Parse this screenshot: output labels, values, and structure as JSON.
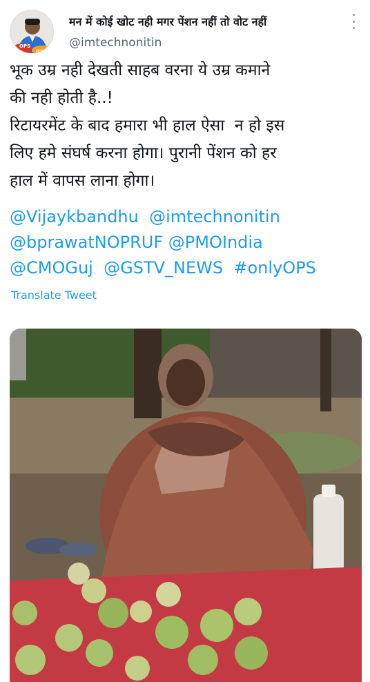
{
  "tweet": {
    "display_name": "मन में कोई खोट नही मगर पेंशन नहीं तो वोट नहीं",
    "handle": "@imtechnonitin",
    "avatar": {
      "badge_text": "OPS",
      "badge_text_2": "संघर्ष",
      "icon": "avatar-photo"
    },
    "more_icon": "more-vertical-icon",
    "text": "भूक उम्र नही देखती साहब वरना ये उम्र कमाने\nकी नही होती है..!\nरिटायरमेंट के बाद हमारा भी हाल ऐसा  न हो इस\nलिए हमे संघर्ष करना होगा। पुरानी पेंशन को हर\nहाल में वापस लाना होगा।",
    "mentions": [
      "@Vijaykbandhu",
      "@imtechnonitin",
      "@bprawatNOPRUF",
      "@PMOIndia",
      "@CMOGuj",
      "@GSTV_NEWS",
      "#onlyOPS"
    ],
    "translate_label": "Translate Tweet",
    "colors": {
      "link": "#1d9bf0",
      "text": "#0f1419",
      "secondary": "#536471"
    }
  }
}
